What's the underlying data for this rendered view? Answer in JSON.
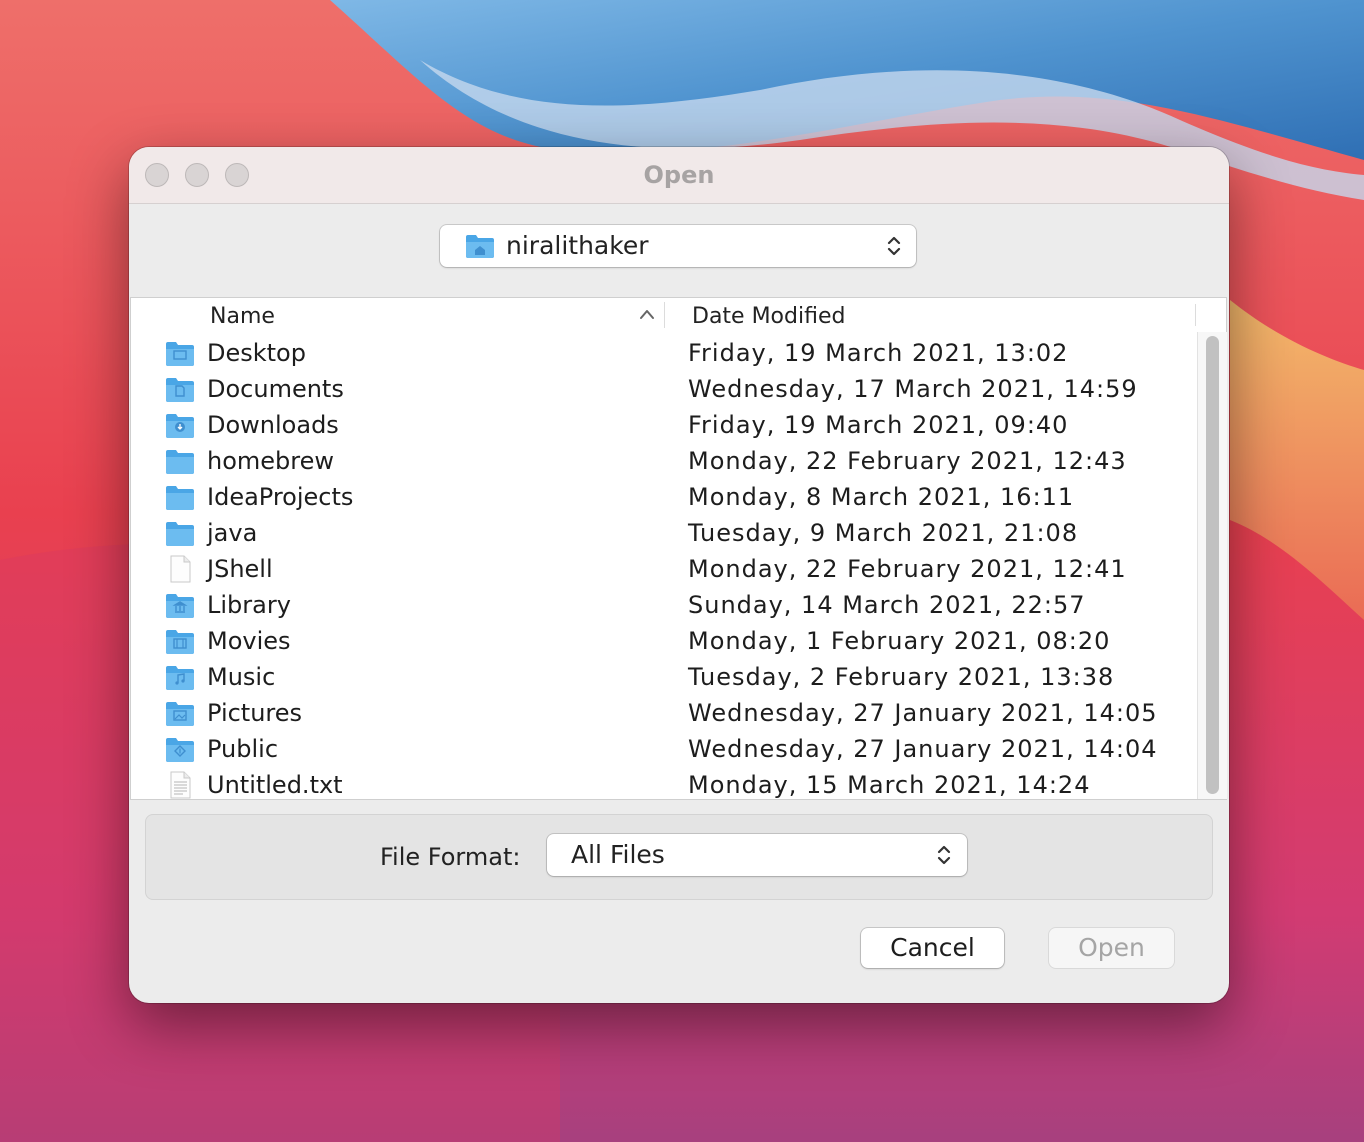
{
  "window": {
    "title": "Open"
  },
  "location": {
    "current_folder": "niralithaker",
    "icon": "home-folder-icon"
  },
  "table": {
    "columns": [
      "Name",
      "Date Modified"
    ],
    "sort": {
      "column": "Name",
      "direction": "ascending"
    },
    "rows": [
      {
        "name": "Desktop",
        "date": "Friday, 19 March 2021, 13:02",
        "icon": "desktop-folder-icon"
      },
      {
        "name": "Documents",
        "date": "Wednesday, 17 March 2021, 14:59",
        "icon": "documents-folder-icon"
      },
      {
        "name": "Downloads",
        "date": "Friday, 19 March 2021, 09:40",
        "icon": "downloads-folder-icon"
      },
      {
        "name": "homebrew",
        "date": "Monday, 22 February 2021, 12:43",
        "icon": "folder-icon"
      },
      {
        "name": "IdeaProjects",
        "date": "Monday, 8 March 2021, 16:11",
        "icon": "folder-icon"
      },
      {
        "name": "java",
        "date": "Tuesday, 9 March 2021, 21:08",
        "icon": "folder-icon"
      },
      {
        "name": "JShell",
        "date": "Monday, 22 February 2021, 12:41",
        "icon": "blank-file-icon"
      },
      {
        "name": "Library",
        "date": "Sunday, 14 March 2021, 22:57",
        "icon": "library-folder-icon"
      },
      {
        "name": "Movies",
        "date": "Monday, 1 February 2021, 08:20",
        "icon": "movies-folder-icon"
      },
      {
        "name": "Music",
        "date": "Tuesday, 2 February 2021, 13:38",
        "icon": "music-folder-icon"
      },
      {
        "name": "Pictures",
        "date": "Wednesday, 27 January 2021, 14:05",
        "icon": "pictures-folder-icon"
      },
      {
        "name": "Public",
        "date": "Wednesday, 27 January 2021, 14:04",
        "icon": "public-folder-icon"
      },
      {
        "name": "Untitled.txt",
        "date": "Monday, 15 March 2021, 14:24",
        "icon": "text-file-icon"
      }
    ]
  },
  "file_format": {
    "label": "File Format:",
    "selected": "All Files"
  },
  "buttons": {
    "cancel": "Cancel",
    "open": "Open"
  },
  "colors": {
    "folder_blue": "#4aa6e6",
    "folder_tab": "#6cbcf0",
    "disabled_text": "#a5a5a5"
  }
}
